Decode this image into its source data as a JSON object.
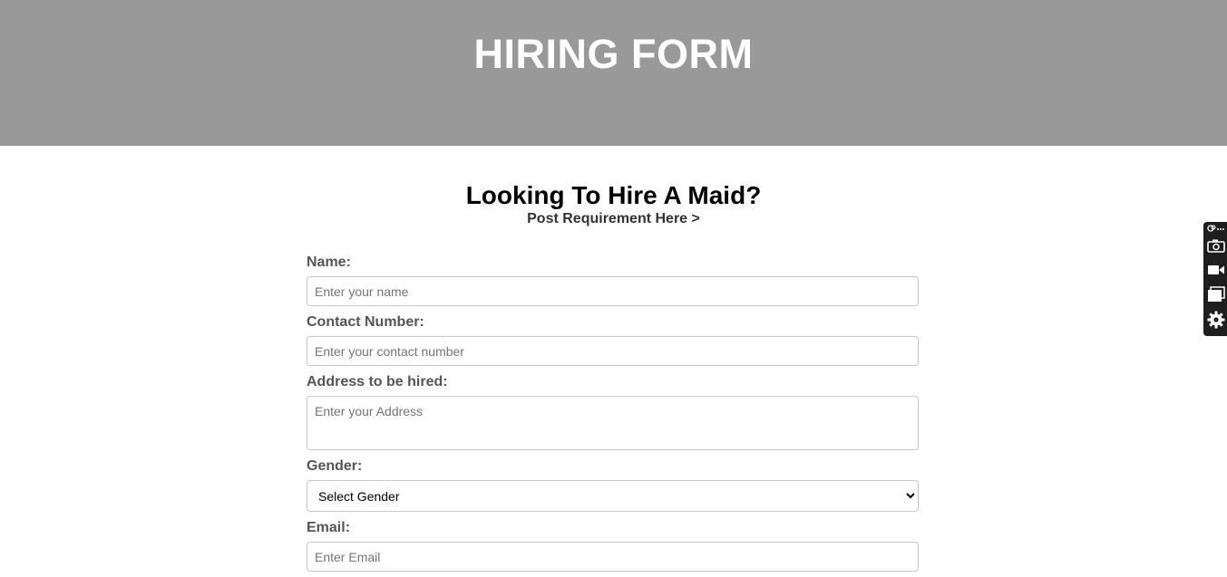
{
  "header": {
    "title": "HIRING FORM"
  },
  "intro": {
    "title": "Looking To Hire A Maid?",
    "subtitle": "Post Requirement Here >"
  },
  "form": {
    "name": {
      "label": "Name:",
      "placeholder": "Enter your name",
      "value": ""
    },
    "contact": {
      "label": "Contact Number:",
      "placeholder": "Enter your contact number",
      "value": ""
    },
    "address": {
      "label": "Address to be hired:",
      "placeholder": "Enter your Address",
      "value": ""
    },
    "gender": {
      "label": "Gender:",
      "selected": "Select Gender"
    },
    "email": {
      "label": "Email:",
      "placeholder": "Enter Email",
      "value": ""
    }
  },
  "toolbar": {
    "icons": [
      "link-more-icon",
      "camera-icon",
      "video-icon",
      "window-icon",
      "gear-icon"
    ],
    "background": "#1e1e1e"
  },
  "colors": {
    "header_bg": "#999999",
    "header_text": "#ffffff",
    "label_text": "#555555"
  }
}
